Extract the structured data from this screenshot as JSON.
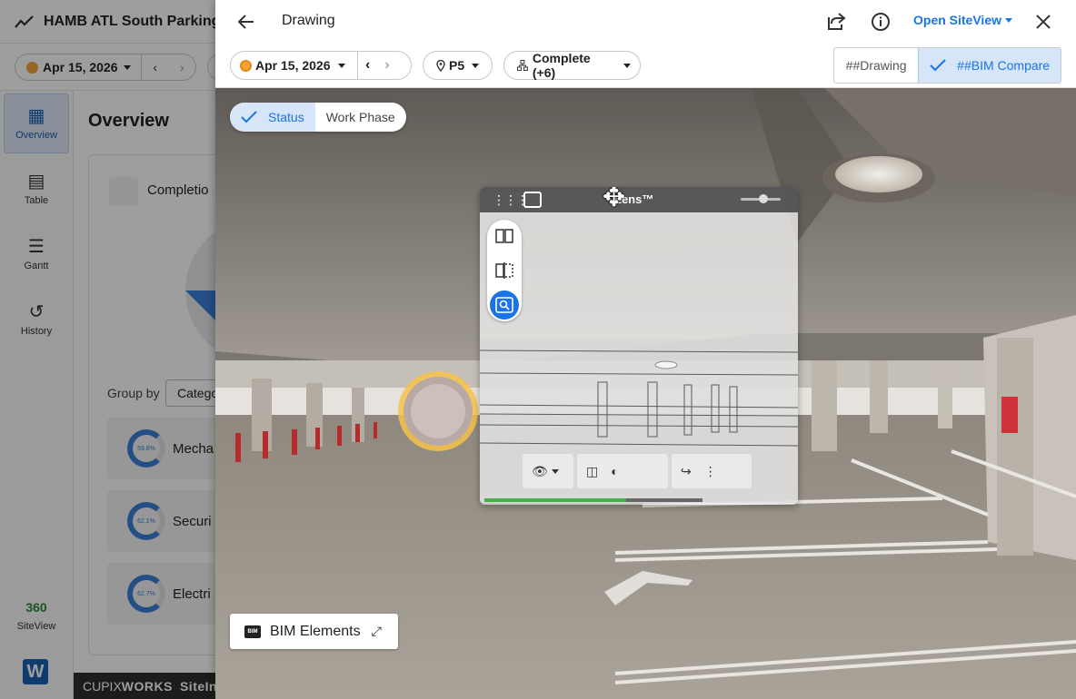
{
  "background_app": {
    "title": "HAMB ATL South Parking",
    "date": "Apr 15, 2026",
    "sidebar": [
      {
        "label": "Overview",
        "icon": "dashboard-icon"
      },
      {
        "label": "Table",
        "icon": "table-icon"
      },
      {
        "label": "Gantt",
        "icon": "gantt-icon"
      },
      {
        "label": "History",
        "icon": "history-icon"
      },
      {
        "label": "SiteView",
        "icon": "siteview-360-icon"
      }
    ],
    "page_title": "Overview",
    "card_title": "Completio",
    "group_by_label": "Group by",
    "group_by_value": "Catego",
    "rows": [
      {
        "label": "Mecha",
        "percent": "59.8%"
      },
      {
        "label": "Securi",
        "percent": "62.1%"
      },
      {
        "label": "Electri",
        "percent": "62.7%"
      }
    ],
    "footer_brand_a": "CUPIX",
    "footer_brand_b": "WORKS",
    "footer_text": "SiteIns"
  },
  "panel": {
    "title": "Drawing",
    "open_siteview": "Open SiteView",
    "date": "Apr 15, 2026",
    "level": "P5",
    "status_filter": "Complete (+6)",
    "compare_options": [
      "##Drawing",
      "##BIM Compare"
    ],
    "compare_selected": "##BIM Compare"
  },
  "viewer": {
    "status_options": [
      "Status",
      "Work Phase"
    ],
    "status_selected": "Status",
    "lens_title": "Lens™",
    "lens_progress": 0.65,
    "bim_elements_label": "BIM Elements",
    "lens_toolbar_icons": [
      "eye-icon",
      "section-icon",
      "contrast-icon",
      "redo-arrow-icon",
      "more-icon"
    ]
  }
}
